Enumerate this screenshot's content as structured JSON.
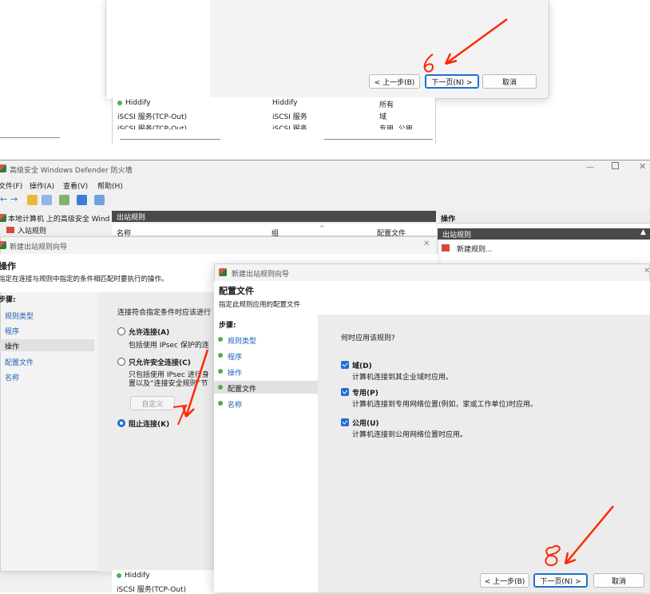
{
  "top_dialog": {
    "back_button": "< 上一步(B)",
    "next_button": "下一页(N) >",
    "cancel_button": "取消",
    "annotation_number": "6"
  },
  "behind_list": {
    "rows": [
      {
        "name": "Hiddify",
        "group": "Hiddify",
        "profile": "所有"
      },
      {
        "name": "iSCSI 服务(TCP-Out)",
        "group": "iSCSI 服务",
        "profile": "域"
      },
      {
        "name": "iSCSI 服务(TCP-Out)",
        "group": "iSCSI 服务",
        "profile": "专用, 公用"
      }
    ]
  },
  "main_window": {
    "title": "高级安全 Windows Defender 防火墙",
    "menu": [
      "文件(F)",
      "操作(A)",
      "查看(V)",
      "帮助(H)"
    ],
    "tree_root": "本地计算机 上的高级安全 Windows",
    "tree_inbound": "入站规则",
    "center_header": "出站规则",
    "col_name": "名称",
    "col_group": "组",
    "col_profile": "配置文件",
    "actions_header": "操作",
    "actions_sub": "出站规则",
    "action_new_rule": "新建规则...",
    "bottom_rows": [
      "Hiddify",
      "iSCSI 服务(TCP-Out)"
    ]
  },
  "wizard1": {
    "title": "新建出站规则向导",
    "heading": "操作",
    "subheading": "指定在连接与规则中指定的条件相匹配时要执行的操作。",
    "steps_label": "步骤:",
    "steps": [
      "规则类型",
      "程序",
      "操作",
      "配置文件",
      "名称"
    ],
    "prompt": "连接符合指定条件时应该进行",
    "opt_allow": "允许连接(A)",
    "opt_allow_desc": "包括使用 IPsec 保护的连",
    "opt_secure": "只允许安全连接(C)",
    "opt_secure_desc1": "只包括使用 IPsec 进行身",
    "opt_secure_desc2": "置以及“连接安全规则”节",
    "custom_button": "自定义",
    "opt_block": "阻止连接(K)"
  },
  "wizard2": {
    "title": "新建出站规则向导",
    "heading": "配置文件",
    "subheading": "指定此规则应用的配置文件",
    "steps_label": "步骤:",
    "steps": [
      "规则类型",
      "程序",
      "操作",
      "配置文件",
      "名称"
    ],
    "question": "何时应用该规则?",
    "domain_label": "域(D)",
    "domain_desc": "计算机连接到其企业域时应用。",
    "private_label": "专用(P)",
    "private_desc": "计算机连接到专用网络位置(例如，家或工作单位)时应用。",
    "public_label": "公用(U)",
    "public_desc": "计算机连接到公用网络位置时应用。",
    "back_button": "< 上一步(B)",
    "next_button": "下一页(N) >",
    "cancel_button": "取消",
    "annotation_number": "8"
  },
  "colors": {
    "accent": "#1f6fd1",
    "annotation": "#ff2a00",
    "header_dark": "#4a4a4a"
  }
}
